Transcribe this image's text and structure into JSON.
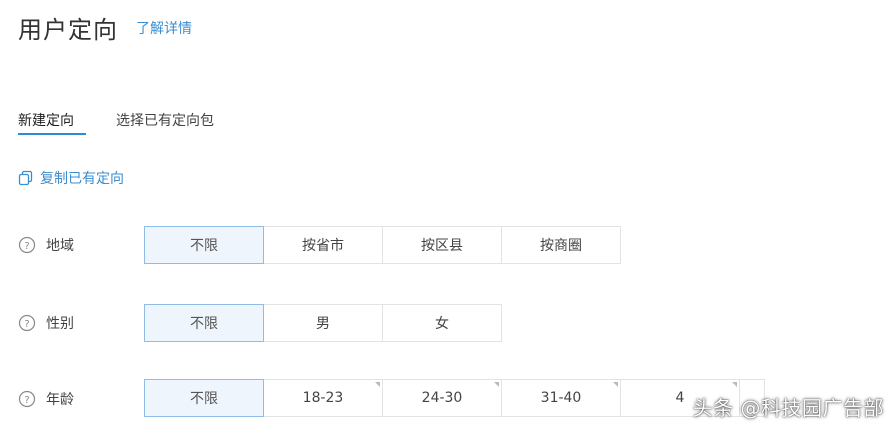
{
  "header": {
    "title": "用户定向",
    "learn_more": "了解详情"
  },
  "tabs": [
    {
      "label": "新建定向",
      "active": true
    },
    {
      "label": "选择已有定向包",
      "active": false
    }
  ],
  "copy_link": "复制已有定向",
  "rows": {
    "region": {
      "label": "地域",
      "options": [
        "不限",
        "按省市",
        "按区县",
        "按商圈"
      ],
      "selected": "不限"
    },
    "gender": {
      "label": "性别",
      "options": [
        "不限",
        "男",
        "女"
      ],
      "selected": "不限"
    },
    "age": {
      "label": "年龄",
      "options": [
        "不限",
        "18-23",
        "24-30",
        "31-40",
        "4",
        ""
      ],
      "selected": "不限"
    }
  },
  "watermark": "头条 @科技园广告部",
  "colors": {
    "accent": "#2d8bd6",
    "link": "#3b8ed0",
    "selected_bg": "#eef5fd",
    "selected_border": "#8fbde8",
    "border": "#e3e3e3"
  }
}
